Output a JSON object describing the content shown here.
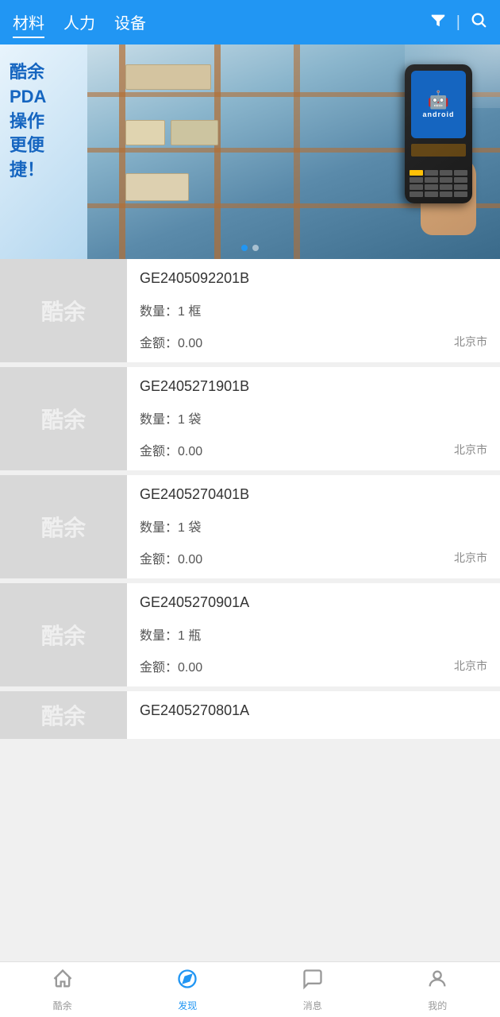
{
  "nav": {
    "tabs": [
      {
        "label": "材料",
        "active": true
      },
      {
        "label": "人力",
        "active": false
      },
      {
        "label": "设备",
        "active": false
      }
    ],
    "filter_icon": "▼",
    "search_icon": "🔍"
  },
  "banner": {
    "text_line1": "酷余",
    "text_line2": "PDA",
    "text_line3": "操作",
    "text_line4": "更便",
    "text_line5": "捷！",
    "dots": [
      true,
      false
    ]
  },
  "items": [
    {
      "id": "GE2405092201B",
      "qty_label": "数量：",
      "qty_value": "1 框",
      "amount_label": "金额：",
      "amount_value": "0.00",
      "location": "北京市",
      "logo": "酷余"
    },
    {
      "id": "GE2405271901B",
      "qty_label": "数量：",
      "qty_value": "1 袋",
      "amount_label": "金额：",
      "amount_value": "0.00",
      "location": "北京市",
      "logo": "酷余"
    },
    {
      "id": "GE2405270401B",
      "qty_label": "数量：",
      "qty_value": "1 袋",
      "amount_label": "金额：",
      "amount_value": "0.00",
      "location": "北京市",
      "logo": "酷余"
    },
    {
      "id": "GE2405270901A",
      "qty_label": "数量：",
      "qty_value": "1 瓶",
      "amount_label": "金额：",
      "amount_value": "0.00",
      "location": "北京市",
      "logo": "酷余"
    },
    {
      "id": "GE2405270801A",
      "qty_label": "",
      "qty_value": "",
      "amount_label": "",
      "amount_value": "",
      "location": "",
      "logo": "酷余",
      "partial": true
    }
  ],
  "bottom_nav": [
    {
      "label": "酷余",
      "icon": "home",
      "active": false
    },
    {
      "label": "发现",
      "icon": "compass",
      "active": true
    },
    {
      "label": "消息",
      "icon": "message",
      "active": false
    },
    {
      "label": "我的",
      "icon": "person",
      "active": false
    }
  ]
}
